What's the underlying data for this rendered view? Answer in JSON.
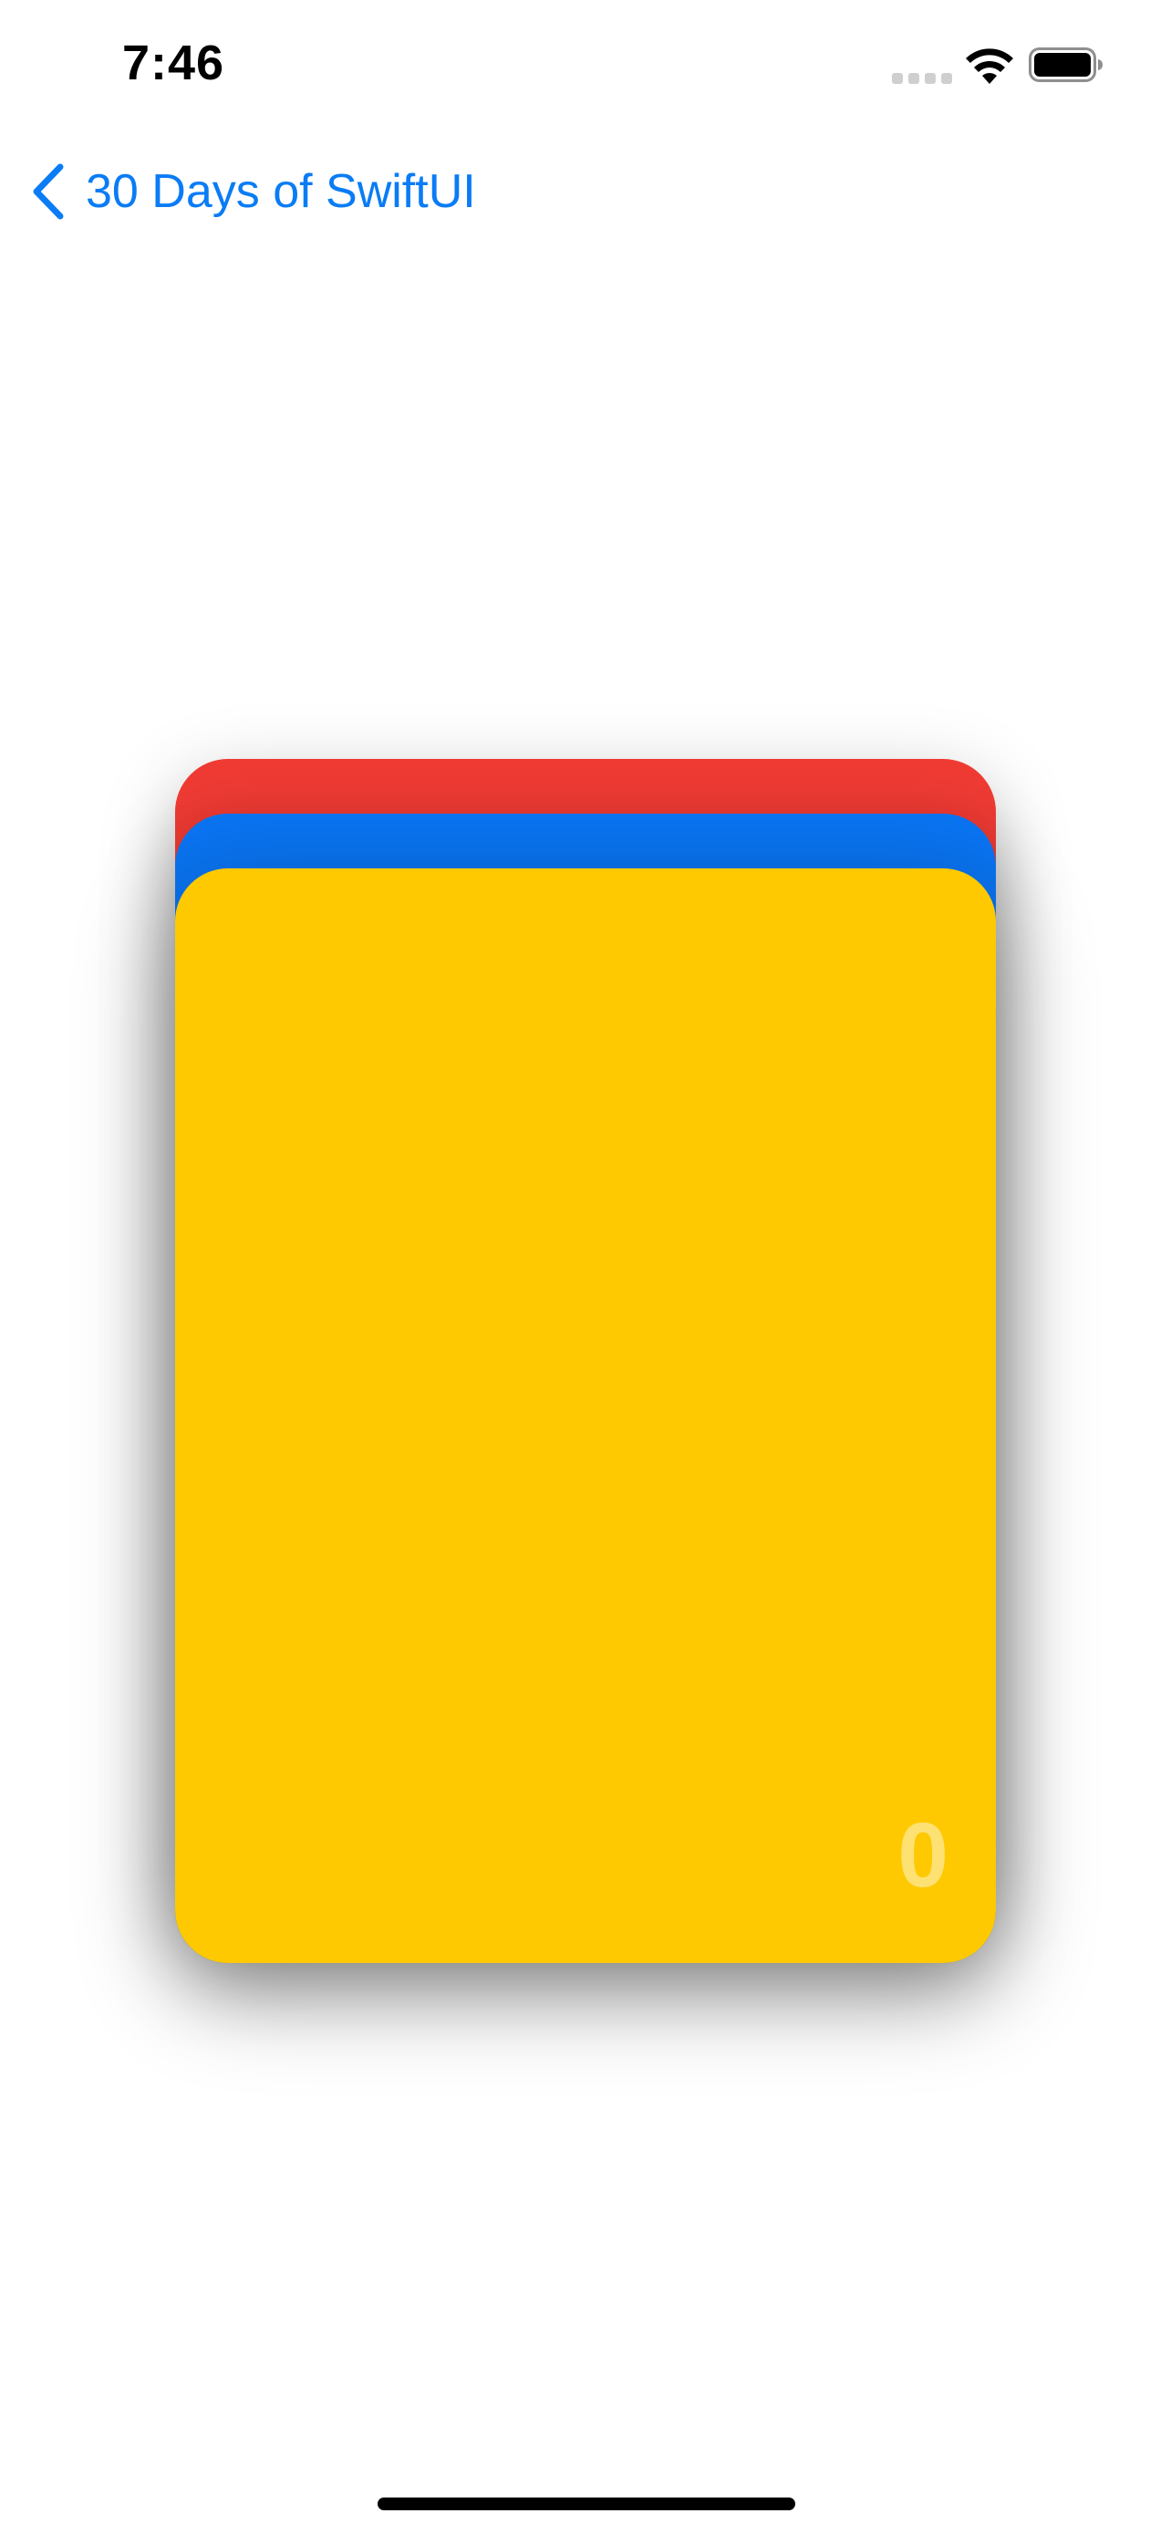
{
  "status_bar": {
    "time": "7:46",
    "signal_icon": "cellular-signal-icon",
    "wifi_icon": "wifi-icon",
    "battery_icon": "battery-icon"
  },
  "nav": {
    "back_label": "30 Days of SwiftUI",
    "back_icon": "chevron-left-icon"
  },
  "cards": [
    {
      "color": "#ef3b34",
      "name": "red"
    },
    {
      "color": "#0a74f2",
      "name": "blue"
    },
    {
      "color": "#fec900",
      "name": "yellow"
    }
  ],
  "front_card": {
    "counter": "0"
  },
  "colors": {
    "accent": "#0a7cf5"
  }
}
